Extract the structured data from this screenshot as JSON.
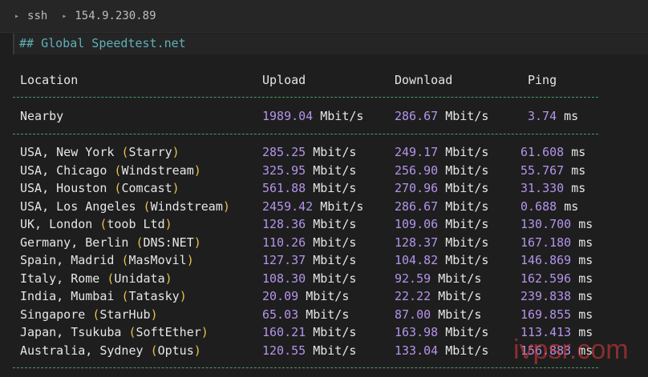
{
  "breadcrumb": [
    "ssh",
    "154.9.230.89"
  ],
  "heading": "## Global Speedtest.net",
  "columns": {
    "location": "Location",
    "upload": "Upload",
    "download": "Download",
    "ping": "Ping"
  },
  "nearby": {
    "location": "Nearby",
    "upload": "1989.04",
    "download": "286.67",
    "ping": "3.74",
    "unit_speed": "Mbit/s",
    "unit_ping": "ms"
  },
  "rows": [
    {
      "city": "USA, New York ",
      "isp": "Starry",
      "upload": "285.25",
      "download": "249.17",
      "ping": "61.608"
    },
    {
      "city": "USA, Chicago ",
      "isp": "Windstream",
      "upload": "325.95",
      "download": "256.90",
      "ping": "55.767"
    },
    {
      "city": "USA, Houston ",
      "isp": "Comcast",
      "upload": "561.88",
      "download": "270.96",
      "ping": "31.330"
    },
    {
      "city": "USA, Los Angeles ",
      "isp": "Windstream",
      "upload": "2459.42",
      "download": "286.67",
      "ping": "0.688"
    },
    {
      "city": "UK, London ",
      "isp": "toob Ltd",
      "upload": "128.36",
      "download": "109.06",
      "ping": "130.700"
    },
    {
      "city": "Germany, Berlin ",
      "isp": "DNS:NET",
      "upload": "110.26",
      "download": "128.37",
      "ping": "167.180"
    },
    {
      "city": "Spain, Madrid ",
      "isp": "MasMovil",
      "upload": "127.37",
      "download": "104.82",
      "ping": "146.869"
    },
    {
      "city": "Italy, Rome ",
      "isp": "Unidata",
      "upload": "108.30",
      "download": "92.59",
      "ping": "162.596"
    },
    {
      "city": "India, Mumbai ",
      "isp": "Tatasky",
      "upload": "20.09",
      "download": "22.22",
      "ping": "239.838"
    },
    {
      "city": "Singapore ",
      "isp": "StarHub",
      "upload": "65.03",
      "download": "87.00",
      "ping": "169.855"
    },
    {
      "city": "Japan, Tsukuba ",
      "isp": "SoftEther",
      "upload": "160.21",
      "download": "163.98",
      "ping": "113.413"
    },
    {
      "city": "Australia, Sydney ",
      "isp": "Optus",
      "upload": "120.55",
      "download": "133.04",
      "ping": "156.883"
    }
  ],
  "units": {
    "speed": "Mbit/s",
    "ping": "ms"
  },
  "watermark": "ivpsr.com"
}
